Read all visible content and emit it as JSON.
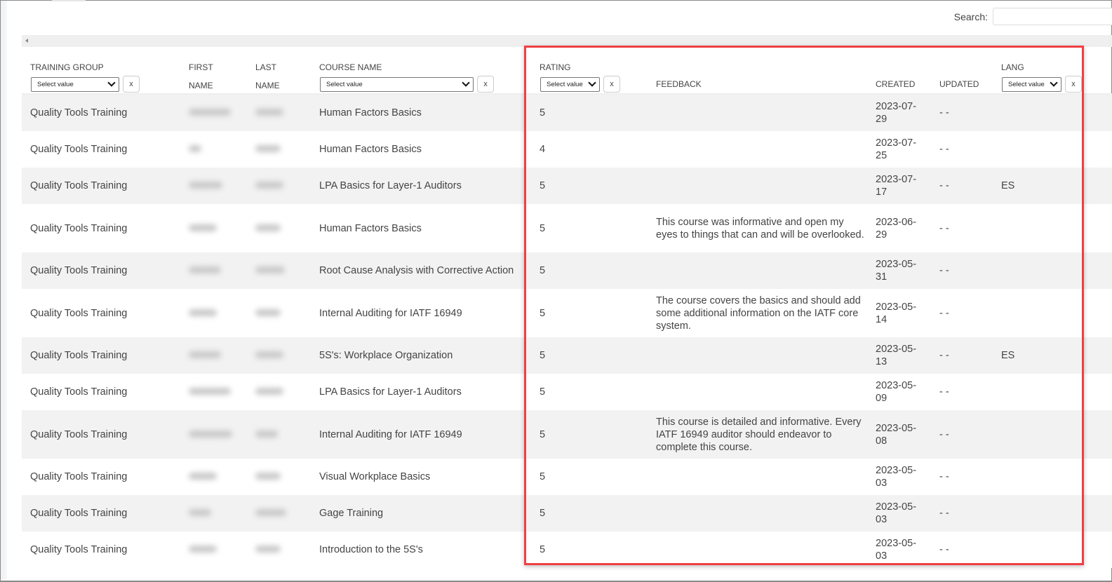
{
  "search": {
    "label": "Search:",
    "value": "",
    "placeholder": ""
  },
  "columns": {
    "training_group": "TRAINING GROUP",
    "first_name": [
      "FIRST",
      "NAME"
    ],
    "last_name": [
      "LAST",
      "NAME"
    ],
    "course_name": "COURSE NAME",
    "rating": "RATING",
    "feedback": "FEEDBACK",
    "created": "CREATED",
    "updated": "UPDATED",
    "lang": "LANG"
  },
  "filters": {
    "select_label": "Select value",
    "clear_label": "x"
  },
  "rows": [
    {
      "group": "Quality Tools Training",
      "course": "Human Factors Basics",
      "rating": "5",
      "feedback": "",
      "created": [
        "2023-07-",
        "29"
      ],
      "updated": "- -",
      "lang": ""
    },
    {
      "group": "Quality Tools Training",
      "course": "Human Factors Basics",
      "rating": "4",
      "feedback": "",
      "created": [
        "2023-07-",
        "25"
      ],
      "updated": "- -",
      "lang": ""
    },
    {
      "group": "Quality Tools Training",
      "course": "LPA Basics for Layer-1 Auditors",
      "rating": "5",
      "feedback": "",
      "created": [
        "2023-07-",
        "17"
      ],
      "updated": "- -",
      "lang": "ES"
    },
    {
      "group": "Quality Tools Training",
      "course": "Human Factors Basics",
      "rating": "5",
      "feedback": "This course was informative and open my eyes to things that can and will be overlooked.",
      "created": [
        "2023-06-",
        "29"
      ],
      "updated": "- -",
      "lang": ""
    },
    {
      "group": "Quality Tools Training",
      "course": "Root Cause Analysis with Corrective Action",
      "rating": "5",
      "feedback": "",
      "created": [
        "2023-05-",
        "31"
      ],
      "updated": "- -",
      "lang": ""
    },
    {
      "group": "Quality Tools Training",
      "course": "Internal Auditing for IATF 16949",
      "rating": "5",
      "feedback": "The course covers the basics and should add some additional information on the IATF core system.",
      "created": [
        "2023-05-",
        "14"
      ],
      "updated": "- -",
      "lang": ""
    },
    {
      "group": "Quality Tools Training",
      "course": "5S's: Workplace Organization",
      "rating": "5",
      "feedback": "",
      "created": [
        "2023-05-",
        "13"
      ],
      "updated": "- -",
      "lang": "ES"
    },
    {
      "group": "Quality Tools Training",
      "course": "LPA Basics for Layer-1 Auditors",
      "rating": "5",
      "feedback": "",
      "created": [
        "2023-05-",
        "09"
      ],
      "updated": "- -",
      "lang": ""
    },
    {
      "group": "Quality Tools Training",
      "course": "Internal Auditing for IATF 16949",
      "rating": "5",
      "feedback": "This course is detailed and informative. Every IATF 16949 auditor should endeavor to complete this course.",
      "created": [
        "2023-05-",
        "08"
      ],
      "updated": "- -",
      "lang": ""
    },
    {
      "group": "Quality Tools Training",
      "course": "Visual Workplace Basics",
      "rating": "5",
      "feedback": "",
      "created": [
        "2023-05-",
        "03"
      ],
      "updated": "- -",
      "lang": ""
    },
    {
      "group": "Quality Tools Training",
      "course": "Gage Training",
      "rating": "5",
      "feedback": "",
      "created": [
        "2023-05-",
        "03"
      ],
      "updated": "- -",
      "lang": ""
    },
    {
      "group": "Quality Tools Training",
      "course": "Introduction to the 5S's",
      "rating": "5",
      "feedback": "",
      "created": [
        "2023-05-",
        "03"
      ],
      "updated": "- -",
      "lang": ""
    }
  ],
  "colors": {
    "highlight": "#ef4043",
    "row_alt": "#f2f2f2"
  }
}
